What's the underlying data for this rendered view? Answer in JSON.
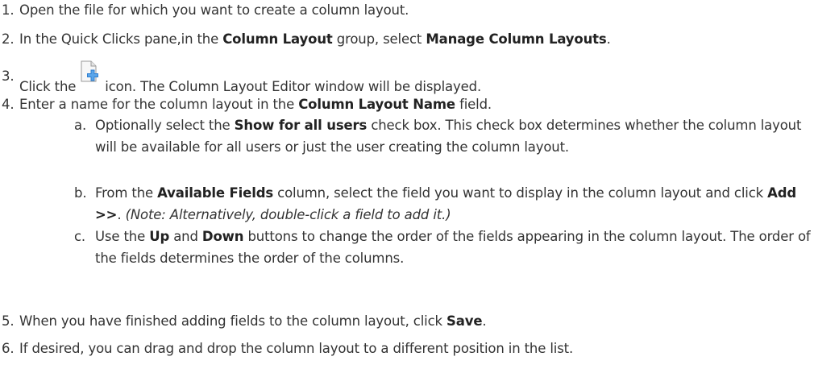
{
  "steps": [
    {
      "num": "1.",
      "parts": [
        {
          "t": "Open the file for which you want to create a column layout."
        }
      ]
    },
    {
      "num": "2.",
      "parts": [
        {
          "t": "In the Quick Clicks pane,in the "
        },
        {
          "t": "Column Layout",
          "b": true
        },
        {
          "t": " group, select "
        },
        {
          "t": "Manage Column Layouts",
          "b": true
        },
        {
          "t": "."
        }
      ]
    },
    {
      "num": "3.",
      "before_icon": "Click the",
      "icon": "new-document-icon",
      "after_icon": "icon. The Column Layout Editor window will be displayed."
    },
    {
      "num": "4.",
      "parts": [
        {
          "t": "Enter a name for the column layout in the "
        },
        {
          "t": "Column Layout Name",
          "b": true
        },
        {
          "t": " field."
        }
      ],
      "substeps": [
        {
          "letter": "a.",
          "parts": [
            {
              "t": "Optionally select the "
            },
            {
              "t": "Show for all users",
              "b": true
            },
            {
              "t": " check box. This check box determines whether the column layout will be available for all users or just the user creating the column layout."
            }
          ]
        },
        {
          "letter": "b.",
          "parts": [
            {
              "t": "From the "
            },
            {
              "t": "Available Fields",
              "b": true
            },
            {
              "t": " column, select the field you want to display in the column layout and click "
            },
            {
              "t": "Add >>",
              "b": true
            },
            {
              "t": ". "
            },
            {
              "t": "(Note: Alternatively, double-click a field to add it.)",
              "i": true
            }
          ]
        },
        {
          "letter": "c.",
          "parts": [
            {
              "t": "Use the "
            },
            {
              "t": "Up",
              "b": true
            },
            {
              "t": " and "
            },
            {
              "t": "Down",
              "b": true
            },
            {
              "t": " buttons to change the order of the fields appearing in the column layout. The order of the fields determines the order of the columns."
            }
          ]
        }
      ]
    },
    {
      "num": "5.",
      "parts": [
        {
          "t": "When you have finished adding fields to the column layout, click "
        },
        {
          "t": "Save",
          "b": true
        },
        {
          "t": "."
        }
      ]
    },
    {
      "num": "6.",
      "parts": [
        {
          "t": "If desired, you can drag and drop the column layout to a different position in the list."
        }
      ]
    }
  ],
  "colors": {
    "text": "#333333",
    "icon_blue": "#2f7fd0"
  }
}
